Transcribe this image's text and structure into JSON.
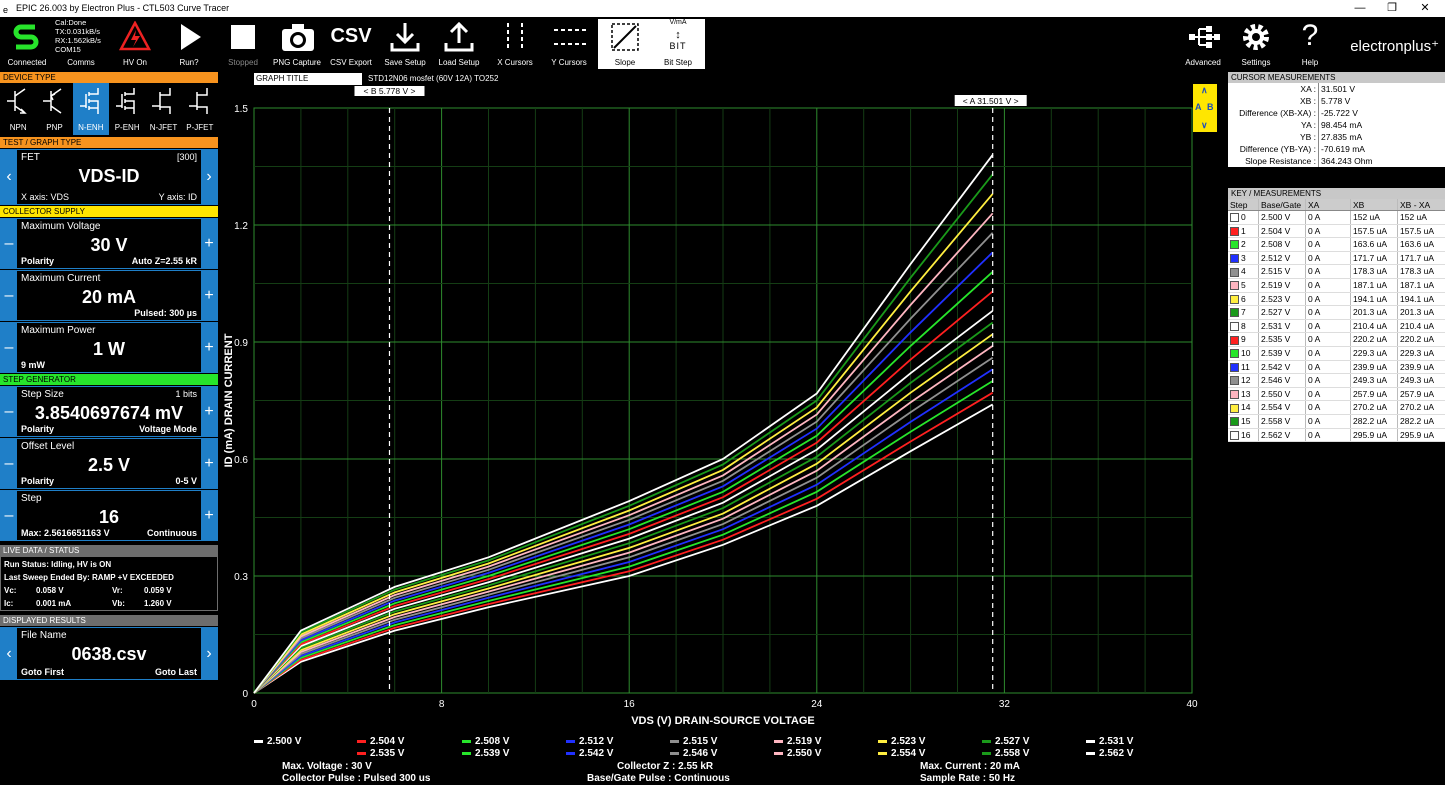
{
  "window": {
    "title": "EPIC 26.003 by Electron Plus - CTL503 Curve Tracer",
    "min": "—",
    "max": "❐",
    "close": "✕"
  },
  "toolbar": {
    "connected": "Connected",
    "status1": "Cal:Done",
    "status2": "TX:0.031kB/s",
    "status3": "RX:1.562kB/s",
    "status4": "COM15",
    "comms": "Comms",
    "hv_on": "HV On",
    "run": "Run?",
    "stopped": "Stopped",
    "png": "PNG Capture",
    "csv": "CSV Export",
    "csv_icon": "CSV",
    "save": "Save Setup",
    "load": "Load Setup",
    "xcur": "X Cursors",
    "ycur": "Y Cursors",
    "slope": "Slope",
    "bitstep": "Bit Step",
    "bit_top": "V/mA",
    "bit_bot": "BIT",
    "advanced": "Advanced",
    "settings": "Settings",
    "help": "Help",
    "logo": "electronplus⁺"
  },
  "device_type": {
    "header": "DEVICE TYPE",
    "items": [
      "NPN",
      "PNP",
      "N-ENH",
      "P-ENH",
      "N-JFET",
      "P-JFET"
    ],
    "selected": "N-ENH"
  },
  "test_graph": {
    "header": "TEST / GRAPH TYPE",
    "title": "FET",
    "code": "[300]",
    "value": "VDS-ID",
    "xaxis": "X axis: VDS",
    "yaxis": "Y axis: ID"
  },
  "collector": {
    "header": "COLLECTOR SUPPLY",
    "max_voltage": {
      "title": "Maximum Voltage",
      "value": "30 V",
      "bl": "Polarity",
      "br": "Auto Z=2.55 kR"
    },
    "max_current": {
      "title": "Maximum Current",
      "value": "20 mA",
      "bl": "",
      "br": "Pulsed: 300 µs"
    },
    "max_power": {
      "title": "Maximum Power",
      "value": "1 W",
      "bl": "9 mW",
      "br": ""
    }
  },
  "step_gen": {
    "header": "STEP GENERATOR",
    "step_size": {
      "title": "Step Size",
      "tr": "1 bits",
      "value": "3.8540697674 mV",
      "bl": "Polarity",
      "br": "Voltage Mode"
    },
    "offset": {
      "title": "Offset Level",
      "value": "2.5 V",
      "bl": "Polarity",
      "br": "0-5 V"
    },
    "step": {
      "title": "Step",
      "value": "16",
      "bl": "Max: 2.5616651163 V",
      "br": "Continuous"
    }
  },
  "live": {
    "header": "LIVE DATA / STATUS",
    "run_status": "Run Status: Idling, HV is ON",
    "last_sweep": "Last Sweep Ended By: RAMP +V EXCEEDED",
    "vc_l": "Vc:",
    "vc": "0.058 V",
    "vr_l": "Vr:",
    "vr": "0.059 V",
    "ic_l": "Ic:",
    "ic": "0.001 mA",
    "vb_l": "Vb:",
    "vb": "1.260 V"
  },
  "results": {
    "header": "DISPLAYED RESULTS",
    "title": "File Name",
    "value": "0638.csv",
    "bl": "Goto First",
    "br": "Goto Last"
  },
  "graph": {
    "title_label": "GRAPH TITLE",
    "title_value": "STD12N06 mosfet (60V 12A) TO252",
    "cursor_b": "<  B 5.778 V  >",
    "cursor_a": "<  A 31.501 V  >",
    "cur_a": "A",
    "cur_b": "B",
    "up": "∧",
    "down": "∨"
  },
  "chart_data": {
    "type": "line",
    "xlabel": "VDS (V) DRAIN-SOURCE VOLTAGE",
    "ylabel": "ID (mA) DRAIN CURRENT",
    "xlim": [
      0,
      40
    ],
    "ylim": [
      0,
      1.5
    ],
    "xticks": [
      "0",
      "8",
      "16",
      "24",
      "32",
      "40"
    ],
    "yticks": [
      "0",
      "0.3",
      "0.6",
      "0.9",
      "1.2",
      "1.5"
    ],
    "grid": true,
    "cursor_xa": 31.501,
    "cursor_xb": 5.778,
    "x": [
      0,
      2,
      6,
      10,
      16,
      20,
      24,
      28,
      31.5
    ],
    "series": [
      {
        "name": "2.500 V",
        "color": "#ffffff",
        "values": [
          0,
          0.08,
          0.16,
          0.22,
          0.3,
          0.38,
          0.48,
          0.62,
          0.74
        ]
      },
      {
        "name": "2.504 V",
        "color": "#ff2020",
        "values": [
          0,
          0.085,
          0.167,
          0.228,
          0.312,
          0.393,
          0.498,
          0.645,
          0.77
        ]
      },
      {
        "name": "2.508 V",
        "color": "#27e52b",
        "values": [
          0,
          0.09,
          0.174,
          0.236,
          0.324,
          0.406,
          0.516,
          0.67,
          0.8
        ]
      },
      {
        "name": "2.512 V",
        "color": "#2030ff",
        "values": [
          0,
          0.095,
          0.181,
          0.244,
          0.336,
          0.42,
          0.534,
          0.695,
          0.83
        ]
      },
      {
        "name": "2.515 V",
        "color": "#909090",
        "values": [
          0,
          0.1,
          0.188,
          0.252,
          0.348,
          0.433,
          0.552,
          0.72,
          0.86
        ]
      },
      {
        "name": "2.519 V",
        "color": "#ffb6c1",
        "values": [
          0,
          0.105,
          0.195,
          0.26,
          0.36,
          0.447,
          0.57,
          0.745,
          0.89
        ]
      },
      {
        "name": "2.523 V",
        "color": "#ffee40",
        "values": [
          0,
          0.11,
          0.202,
          0.268,
          0.372,
          0.46,
          0.588,
          0.77,
          0.92
        ]
      },
      {
        "name": "2.527 V",
        "color": "#1a9a1a",
        "values": [
          0,
          0.115,
          0.209,
          0.276,
          0.384,
          0.474,
          0.606,
          0.795,
          0.95
        ]
      },
      {
        "name": "2.531 V",
        "color": "#ffffff",
        "values": [
          0,
          0.12,
          0.216,
          0.284,
          0.396,
          0.488,
          0.624,
          0.82,
          0.98
        ]
      },
      {
        "name": "2.535 V",
        "color": "#ff2020",
        "values": [
          0,
          0.125,
          0.223,
          0.292,
          0.408,
          0.502,
          0.642,
          0.855,
          1.03
        ]
      },
      {
        "name": "2.539 V",
        "color": "#27e52b",
        "values": [
          0,
          0.13,
          0.23,
          0.3,
          0.42,
          0.516,
          0.66,
          0.89,
          1.08
        ]
      },
      {
        "name": "2.542 V",
        "color": "#2030ff",
        "values": [
          0,
          0.135,
          0.237,
          0.308,
          0.432,
          0.53,
          0.678,
          0.925,
          1.13
        ]
      },
      {
        "name": "2.546 V",
        "color": "#909090",
        "values": [
          0,
          0.14,
          0.244,
          0.316,
          0.444,
          0.544,
          0.696,
          0.96,
          1.18
        ]
      },
      {
        "name": "2.550 V",
        "color": "#ffb6c1",
        "values": [
          0,
          0.145,
          0.251,
          0.324,
          0.456,
          0.558,
          0.714,
          0.995,
          1.23
        ]
      },
      {
        "name": "2.554 V",
        "color": "#ffee40",
        "values": [
          0,
          0.15,
          0.258,
          0.332,
          0.468,
          0.572,
          0.732,
          1.03,
          1.28
        ]
      },
      {
        "name": "2.558 V",
        "color": "#1a9a1a",
        "values": [
          0,
          0.155,
          0.265,
          0.34,
          0.48,
          0.586,
          0.75,
          1.065,
          1.33
        ]
      },
      {
        "name": "2.562 V",
        "color": "#ffffff",
        "values": [
          0,
          0.16,
          0.272,
          0.348,
          0.492,
          0.6,
          0.768,
          1.1,
          1.38
        ]
      }
    ]
  },
  "legend": {
    "items": [
      "2.500 V",
      "2.504 V",
      "2.508 V",
      "2.512 V",
      "2.515 V",
      "2.519 V",
      "2.523 V",
      "2.527 V",
      "2.531 V",
      "2.535 V",
      "2.539 V",
      "2.542 V",
      "2.546 V",
      "2.550 V",
      "2.554 V",
      "2.558 V",
      "2.562 V"
    ],
    "info": [
      "Max. Voltage : 30 V",
      "Collector Z : 2.55 kR",
      "Max. Current : 20 mA",
      "Collector Pulse : Pulsed 300 us",
      "Base/Gate Pulse  : Continuous",
      "Sample Rate : 50 Hz"
    ]
  },
  "cursor_meas": {
    "header": "CURSOR MEASUREMENTS",
    "rows": [
      [
        "XA :",
        "31.501 V"
      ],
      [
        "XB :",
        "5.778 V"
      ],
      [
        "Difference (XB-XA) :",
        "-25.722 V"
      ],
      [
        "YA :",
        "98.454 mA"
      ],
      [
        "YB :",
        "27.835 mA"
      ],
      [
        "Difference (YB-YA) :",
        "-70.619 mA"
      ],
      [
        "Slope Resistance :",
        "364.243 Ohm"
      ]
    ]
  },
  "key": {
    "header": "KEY / MEASUREMENTS",
    "cols": [
      "Step",
      "Base/Gate",
      "XA",
      "XB",
      "XB - XA"
    ],
    "rows": [
      [
        "0",
        "2.500 V",
        "0 A",
        "152 uA",
        "152 uA",
        "#ffffff"
      ],
      [
        "1",
        "2.504 V",
        "0 A",
        "157.5 uA",
        "157.5 uA",
        "#ff2020"
      ],
      [
        "2",
        "2.508 V",
        "0 A",
        "163.6 uA",
        "163.6 uA",
        "#27e52b"
      ],
      [
        "3",
        "2.512 V",
        "0 A",
        "171.7 uA",
        "171.7 uA",
        "#2030ff"
      ],
      [
        "4",
        "2.515 V",
        "0 A",
        "178.3 uA",
        "178.3 uA",
        "#909090"
      ],
      [
        "5",
        "2.519 V",
        "0 A",
        "187.1 uA",
        "187.1 uA",
        "#ffb6c1"
      ],
      [
        "6",
        "2.523 V",
        "0 A",
        "194.1 uA",
        "194.1 uA",
        "#ffee40"
      ],
      [
        "7",
        "2.527 V",
        "0 A",
        "201.3 uA",
        "201.3 uA",
        "#1a9a1a"
      ],
      [
        "8",
        "2.531 V",
        "0 A",
        "210.4 uA",
        "210.4 uA",
        "#ffffff"
      ],
      [
        "9",
        "2.535 V",
        "0 A",
        "220.2 uA",
        "220.2 uA",
        "#ff2020"
      ],
      [
        "10",
        "2.539 V",
        "0 A",
        "229.3 uA",
        "229.3 uA",
        "#27e52b"
      ],
      [
        "11",
        "2.542 V",
        "0 A",
        "239.9 uA",
        "239.9 uA",
        "#2030ff"
      ],
      [
        "12",
        "2.546 V",
        "0 A",
        "249.3 uA",
        "249.3 uA",
        "#909090"
      ],
      [
        "13",
        "2.550 V",
        "0 A",
        "257.9 uA",
        "257.9 uA",
        "#ffb6c1"
      ],
      [
        "14",
        "2.554 V",
        "0 A",
        "270.2 uA",
        "270.2 uA",
        "#ffee40"
      ],
      [
        "15",
        "2.558 V",
        "0 A",
        "282.2 uA",
        "282.2 uA",
        "#1a9a1a"
      ],
      [
        "16",
        "2.562 V",
        "0 A",
        "295.9 uA",
        "295.9 uA",
        "#ffffff"
      ]
    ]
  }
}
